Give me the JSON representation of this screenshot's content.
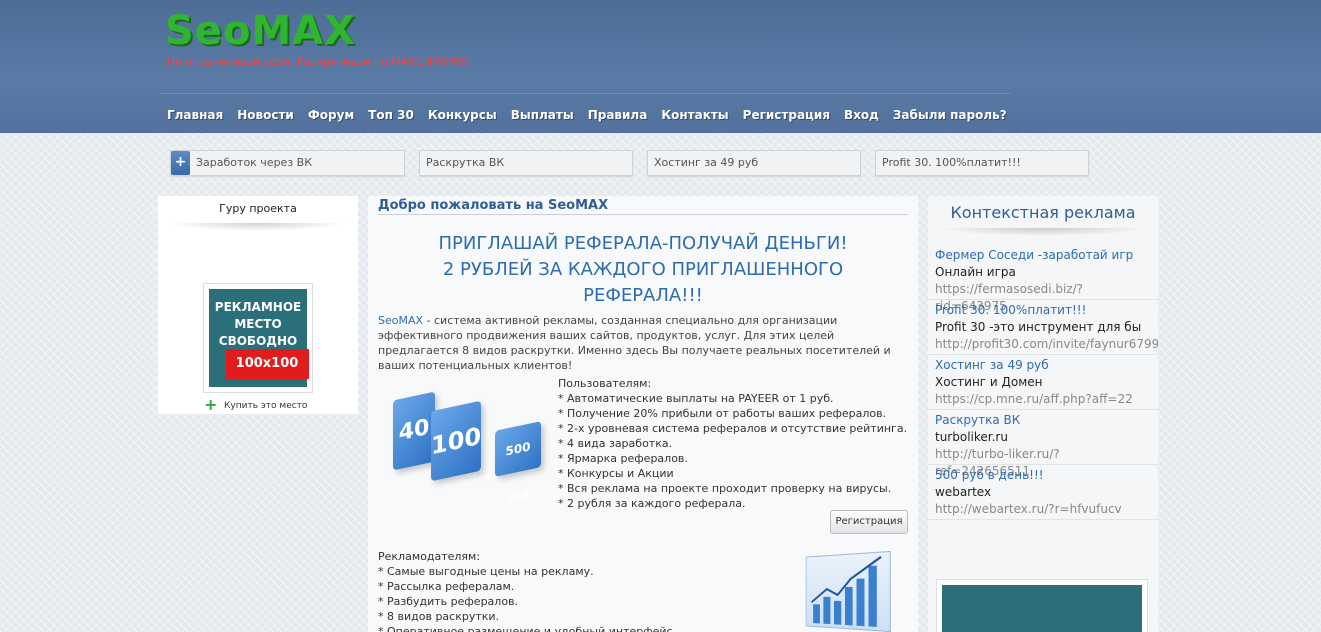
{
  "header": {
    "logo": "SeoMAX",
    "slogan": "Не ограничивай себя. Раскручивай по МАКСИМУМУ!",
    "nav": [
      "Главная",
      "Новости",
      "Форум",
      "Топ 30",
      "Конкурсы",
      "Выплаты",
      "Правила",
      "Контакты",
      "Регистрация",
      "Вход",
      "Забыли пароль?"
    ]
  },
  "toplinks": {
    "plus": "+",
    "items": [
      "Заработок через ВК",
      "Раскрутка ВК",
      "Хостинг за 49 руб",
      "Profit 30. 100%платит!!!"
    ]
  },
  "left": {
    "title": "Гуру проекта",
    "banner_l1": "РЕКЛАМНОЕ",
    "banner_l2": "МЕСТО",
    "banner_l3": "СВОБОДНО",
    "banner_size": "100x100",
    "buy_plus": "+",
    "buy_label": "Купить это место"
  },
  "main": {
    "title": "Добро пожаловать на SeoMAX",
    "promo_1": "ПРИГЛАШАЙ РЕФЕРАЛА-ПОЛУЧАЙ ДЕНЬГИ!",
    "promo_2": "2 РУБЛЕЙ ЗА КАЖДОГО ПРИГЛАШЕННОГО РЕФЕРАЛА!!!",
    "intro_brand": "SeoMAX",
    "intro_text": " - система активной рекламы, созданная специально для организации эффективного продвижения ваших сайтов, продуктов, услуг. Для этих целей предлагается 8 видов раскрутки. Именно здесь Вы получаете реальных посетителей и ваших потенциальных клиентов!",
    "cube_1": "40",
    "cube_2": "100",
    "cube_3": "500",
    "cube_4": "350",
    "users_heading": "Пользователям:",
    "users_items": [
      "* Автоматические выплаты на PAYEER от 1 руб.",
      "* Получение 20% прибыли от работы ваших рефералов.",
      "* 2-х уровневая система рефералов и отсутствие рейтинга.",
      "* 4 вида заработка.",
      "* Ярмарка рефералов.",
      "* Конкурсы и Акции",
      "* Вся реклама на проекте проходит проверку на вирусы.",
      "* 2 рубля за каждого реферала."
    ],
    "register_button": "Регистрация",
    "advert_heading": "Рекламодателям:",
    "advert_items": [
      "* Самые выгодные цены на рекламу.",
      "* Рассылка рефералам.",
      "* Разбудить рефералов.",
      "* 8 видов раскрутки.",
      "* Оперативное размещение и удобный интерфейс."
    ]
  },
  "right": {
    "title": "Контекстная реклама",
    "ads": [
      {
        "title": "Фермер Соседи -заработай игр",
        "desc": "Онлайн игра",
        "url": "https://fermasosedi.biz/?rid=643975"
      },
      {
        "title": "Profit 30. 100%платит!!!",
        "desc": "Profit 30 -это инструмент для бы",
        "url": "http://profit30.com/invite/faynur6799"
      },
      {
        "title": "Хостинг за 49 руб",
        "desc": "Хостинг и Домен",
        "url": "https://cp.mne.ru/aff.php?aff=22"
      },
      {
        "title": "Раскрутка ВК",
        "desc": "turboliker.ru",
        "url": "http://turbo-liker.ru/?ref=242656511"
      },
      {
        "title": "500 руб в день!!!",
        "desc": "webartex",
        "url": "http://webartex.ru/?r=hfvufucv"
      }
    ]
  },
  "colors": {
    "header_bg": "#52729d",
    "logo": "#2fb52f",
    "slogan": "#ff4040",
    "link": "#2f6bb1",
    "banner_red": "#e21c1c",
    "banner_teal": "#2b6f7a"
  }
}
